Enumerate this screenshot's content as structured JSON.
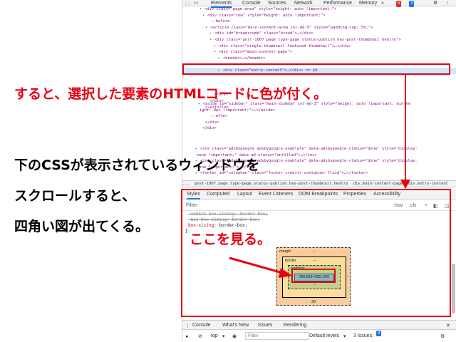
{
  "devtools": {
    "tabs": {
      "elements": "Elements",
      "console": "Console",
      "sources": "Sources",
      "network": "Network",
      "performance": "Performance",
      "memory": "Memory",
      "errors": "5",
      "issues": "3"
    },
    "code_lines": [
      "<div class=\"page-area\" style=\"height: auto !important;\">",
      "<div class=\"row\" style=\"height: auto !important;\">",
      "::before",
      "<article class=\"main-content-area col-md-9\" style=\"padding-top: 5%;\">",
      "<div id=\"breadcrumb\" class=\"bread\">…</div>",
      "<div class=\"post-1007 page type-page status-publish has-post-thumbnail hentry\">",
      "<div class=\"single-thumbnail featured-thumbnail\">…</div>",
      "<div class=\"main-content-page\">",
      "<header>…</header>",
      "<div class=\"entry-content\">…</div> == $0",
      "</div>",
      "</div>",
      "</article>",
      "<aside id=\"sidebar\" class=\"main-sidebar col-md-3\" style=\"height: auto !important; min-he",
      "ight: 0px !important;\">…</aside>",
      "::after",
      "</div>",
      "</div>",
      "<ins class=\"adsbygoogle adsbygoogle-noablate\" data-adsbygoogle-status=\"done\" style=\"display:",
      "none !important;\" data-ad-status=\"unfilled\">…</ins>",
      "<ins class=\"adsbygoogle adsbygoogle-noablate\" data-adsbygoogle-status=\"done\" style=\"display:",
      "none !important;\">…</ins>",
      "<footer id=\"colophon\" class=\"footer-credits container-fluid\">…</footer>"
    ],
    "breadcrumbs": [
      "...",
      "post-1007.page.type-page.status-publish.has-post-thumbnail.hentry",
      "div.main-content-page",
      "div.entry-content"
    ],
    "styles_tabs": {
      "styles": "Styles",
      "computed": "Computed",
      "layout": "Layout",
      "event_listeners": "Event Listeners",
      "dom_breakpoints": "DOM Breakpoints",
      "properties": "Properties",
      "accessibility": "Accessibility"
    },
    "filter": {
      "placeholder": "Filter",
      "hov": ":hov",
      "cls": ".cls",
      "plus": "+"
    },
    "css_lines": [
      {
        "prop": "-webkit-box-sizing",
        "val": "border-box;",
        "struck": true
      },
      {
        "prop": "-moz-box-sizing",
        "val": "border-box;",
        "struck": true
      },
      {
        "prop": "box-sizing",
        "val": "border-box;",
        "struck": false
      }
    ],
    "css_close": "}",
    "box_model": {
      "margin_label": "margin",
      "margin_top": "–",
      "margin_bottom": "30",
      "margin_left": "–",
      "margin_right": "–",
      "border_label": "border",
      "border_val": "–",
      "padding_label": "padding",
      "padding_val": "–",
      "content": "580.593×4251.660"
    },
    "console": {
      "tab_console": "Console",
      "tab_whats_new": "What's New",
      "tab_issues": "Issues",
      "tab_rendering": "Rendering",
      "context": "top",
      "filter_placeholder": "Filter",
      "levels": "Default levels",
      "issues_count": "3 Issues:",
      "issues_badge": "3"
    }
  },
  "annotations": {
    "line1": "すると、選択した要素のHTMLコードに色が付く。",
    "line2": "下のCSSが表示されているウィンドウを",
    "line3": "スクロールすると、",
    "line4": "四角い図が出てくる。",
    "line5": "ここを見る。"
  },
  "colors": {
    "annotation_red": "#e60012",
    "selection_blue": "#cfe8fc"
  }
}
